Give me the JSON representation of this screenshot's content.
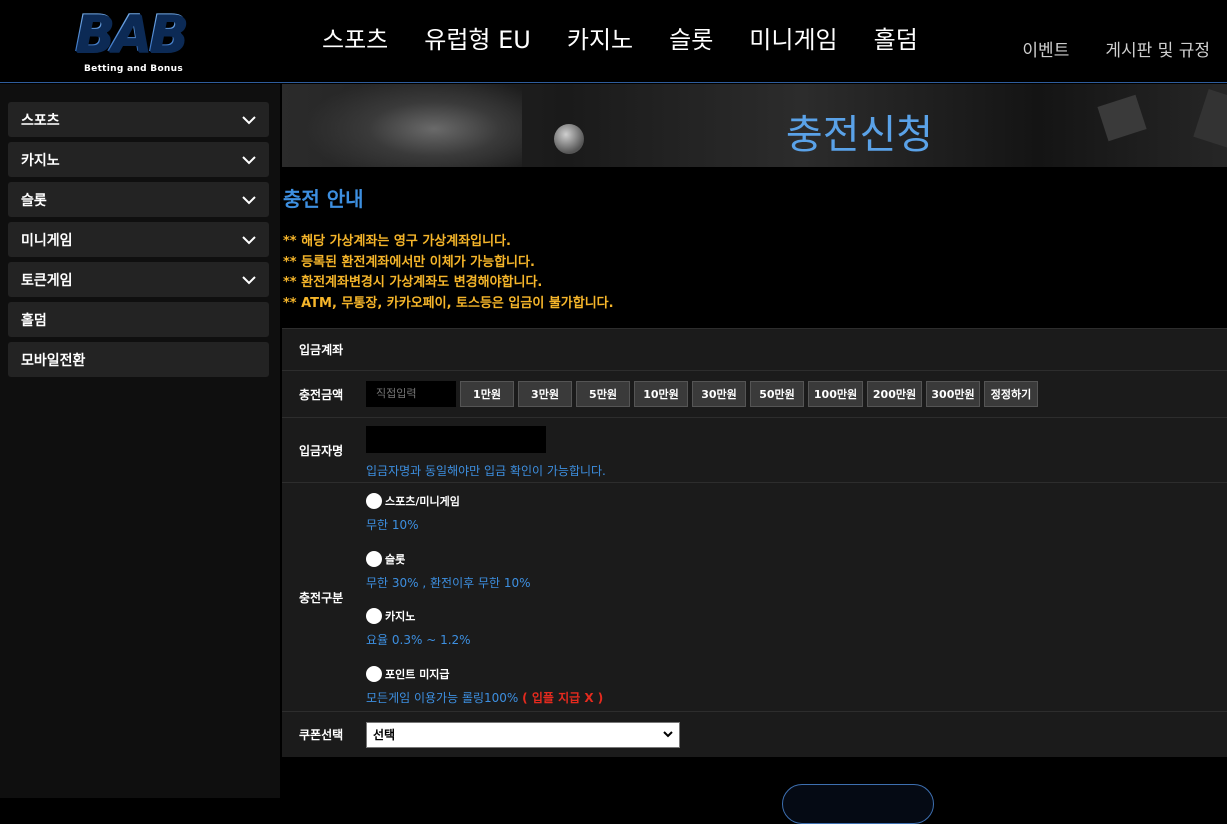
{
  "header": {
    "logo": {
      "mark": "BAB",
      "subtitle": "Betting and Bonus"
    },
    "main_nav": [
      "스포츠",
      "유럽형 EU",
      "카지노",
      "슬롯",
      "미니게임",
      "홀덤"
    ],
    "sub_nav": [
      "이벤트",
      "게시판 및 규정"
    ]
  },
  "sidebar": {
    "items": [
      {
        "label": "스포츠",
        "has_chevron": true
      },
      {
        "label": "카지노",
        "has_chevron": true
      },
      {
        "label": "슬롯",
        "has_chevron": true
      },
      {
        "label": "미니게임",
        "has_chevron": true
      },
      {
        "label": "토큰게임",
        "has_chevron": true
      },
      {
        "label": "홀덤",
        "has_chevron": false
      },
      {
        "label": "모바일전환",
        "has_chevron": false
      }
    ]
  },
  "banner": {
    "title": "충전신청"
  },
  "info": {
    "title": "충전 안내",
    "notices": [
      "** 해당 가상계좌는 영구 가상계좌입니다.",
      "** 등록된 환전계좌에서만 이체가 가능합니다.",
      "** 환전계좌변경시 가상계좌도 변경해야합니다.",
      "** ATM, 무통장, 카카오페이, 토스등은 입금이 불가합니다."
    ]
  },
  "form": {
    "account_label": "입금계좌",
    "amount_label": "충전금액",
    "amount_placeholder": "직접입력",
    "amount_buttons": [
      "1만원",
      "3만원",
      "5만원",
      "10만원",
      "30만원",
      "50만원",
      "100만원",
      "200만원",
      "300만원",
      "정정하기"
    ],
    "depositor_label": "입금자명",
    "depositor_hint": "입금자명과 동일해야만 입금 확인이 가능합니다.",
    "type_label": "충전구분",
    "types": [
      {
        "name": "스포츠/미니게임",
        "desc": "무한 10%",
        "warning": ""
      },
      {
        "name": "슬롯",
        "desc": "무한 30% , 환전이후 무한 10%",
        "warning": ""
      },
      {
        "name": "카지노",
        "desc": "요율 0.3% ~ 1.2%",
        "warning": ""
      },
      {
        "name": "포인트 미지급",
        "desc": "모든게임 이용가능 롤링100%",
        "warning": "( 입플 지급 X )"
      }
    ],
    "coupon_label": "쿠폰선택",
    "coupon_selected": "선택"
  },
  "colors": {
    "accent_blue": "#3d8fe0",
    "notice_orange": "#f5b52a",
    "warning_red": "#e52a1e"
  }
}
